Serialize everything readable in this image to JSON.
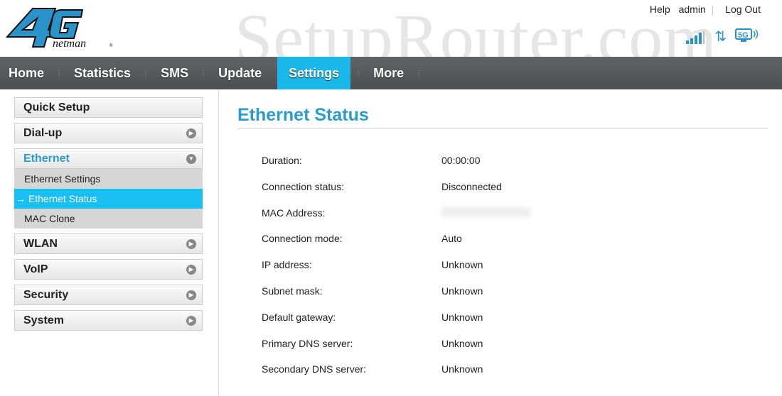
{
  "header": {
    "logo_text": "4G netman",
    "watermark": "SetupRouter.com",
    "links": [
      "Help",
      "admin",
      "Log Out"
    ],
    "status_icons": [
      "signal-icon",
      "data-transfer-icon",
      "5g-wifi-icon"
    ]
  },
  "nav": [
    "Home",
    "Statistics",
    "SMS",
    "Update",
    "Settings",
    "More"
  ],
  "nav_active": "Settings",
  "sidebar": {
    "quick_setup": "Quick Setup",
    "dialup": "Dial-up",
    "ethernet": "Ethernet",
    "ethernet_sub": [
      "Ethernet Settings",
      "→ Ethernet Status",
      "MAC Clone"
    ],
    "rest": [
      "WLAN",
      "VoIP",
      "Security",
      "System"
    ]
  },
  "main": {
    "title": "Ethernet Status",
    "rows": [
      [
        "Duration:",
        "00:00:00"
      ],
      [
        "Connection status:",
        "Disconnected"
      ],
      [
        "MAC Address:",
        ""
      ],
      [
        "Connection mode:",
        "Auto"
      ],
      [
        "IP address:",
        "Unknown"
      ],
      [
        "Subnet mask:",
        "Unknown"
      ],
      [
        "Default gateway:",
        "Unknown"
      ],
      [
        "Primary DNS server:",
        "Unknown"
      ],
      [
        "Secondary DNS server:",
        "Unknown"
      ]
    ]
  },
  "colors": {
    "accent": "#19b7ea",
    "title": "#2a9dc9",
    "nav": "#535959"
  }
}
